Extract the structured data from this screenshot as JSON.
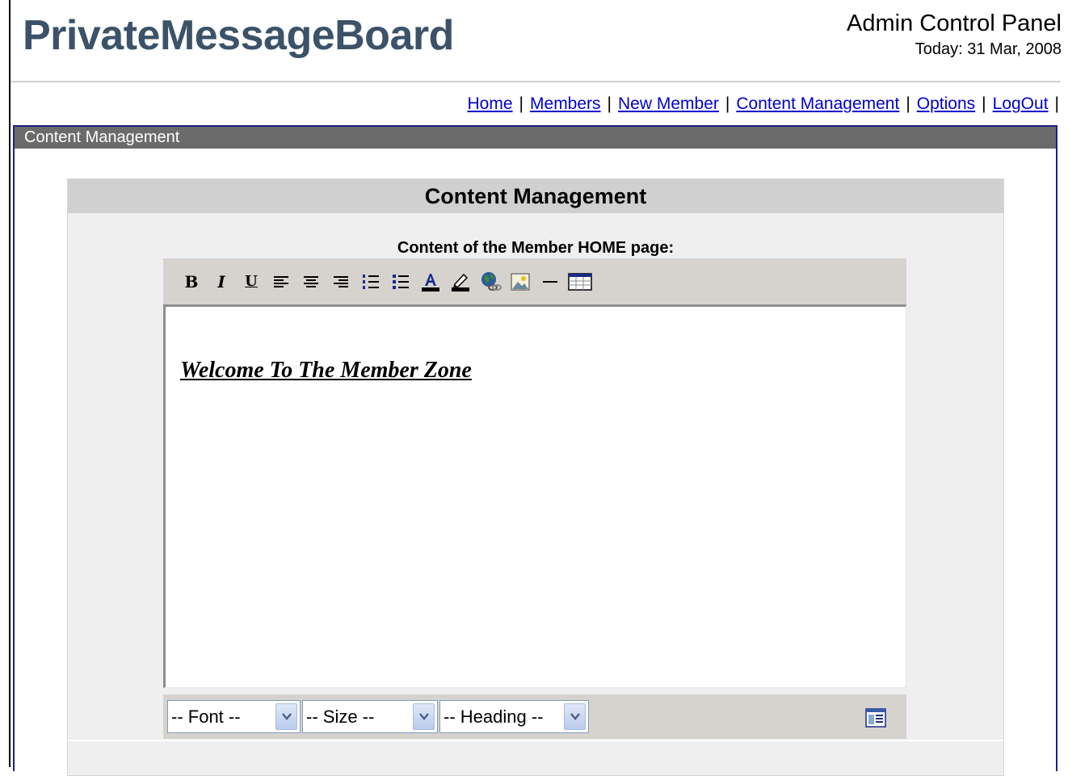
{
  "header": {
    "site_title": "PrivateMessageBoard",
    "panel_title": "Admin Control Panel",
    "today": "Today: 31 Mar, 2008"
  },
  "nav": {
    "items": [
      {
        "label": "Home "
      },
      {
        "label": "Members "
      },
      {
        "label": "New Member "
      },
      {
        "label": "Content Management "
      },
      {
        "label": "Options "
      },
      {
        "label": "LogOut "
      }
    ],
    "separator": "|"
  },
  "panel": {
    "header_label": "Content Management",
    "title": "Content Management",
    "content_label": "Content of the Member HOME page:"
  },
  "editor": {
    "toolbar": [
      {
        "icon": "bold-icon",
        "glyph": "B"
      },
      {
        "icon": "italic-icon",
        "glyph": "I"
      },
      {
        "icon": "underline-icon",
        "glyph": "U"
      },
      {
        "icon": "align-left-icon"
      },
      {
        "icon": "align-center-icon"
      },
      {
        "icon": "align-right-icon"
      },
      {
        "icon": "ordered-list-icon"
      },
      {
        "icon": "unordered-list-icon"
      },
      {
        "icon": "text-color-icon"
      },
      {
        "icon": "highlight-color-icon"
      },
      {
        "icon": "insert-link-icon"
      },
      {
        "icon": "insert-image-icon"
      },
      {
        "icon": "horizontal-rule-icon"
      },
      {
        "icon": "insert-table-icon"
      }
    ],
    "content": "Welcome To The Member Zone",
    "font_select": "-- Font --",
    "size_select": "-- Size --",
    "heading_select": "-- Heading --",
    "toggle_icon": "html-source-icon"
  },
  "colors": {
    "title": "#3b5268",
    "panel_border": "#1e2280",
    "panel_header_bg": "#6b6b6b",
    "link": "#0000cc",
    "toolbar_bg": "#d6d3ce"
  }
}
